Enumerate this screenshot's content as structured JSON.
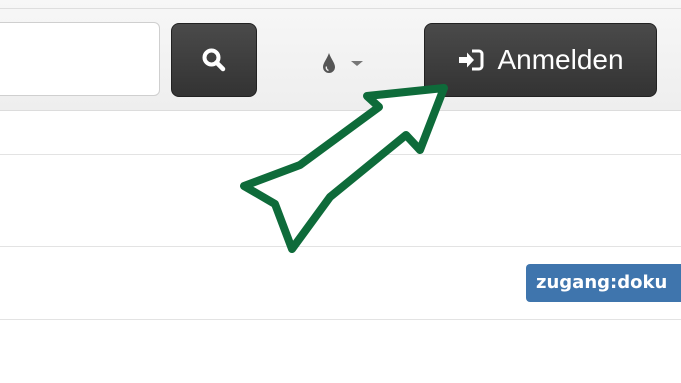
{
  "navbar": {
    "search": {
      "value": "",
      "placeholder": "",
      "button_icon": "search-icon"
    },
    "theme_toggle": {
      "icon": "droplet-icon",
      "caret_icon": "caret-down-icon"
    },
    "login": {
      "label": "Anmelden",
      "icon": "sign-in-icon"
    }
  },
  "content": {
    "tag_badge": "zugang:doku"
  },
  "annotation": {
    "arrow_color": "#0e6b3a",
    "points_to": "login-button"
  },
  "colors": {
    "button_dark": "#3a3a3a",
    "badge_blue": "#3f75ad",
    "navbar_bg": "#f2f2f2"
  }
}
